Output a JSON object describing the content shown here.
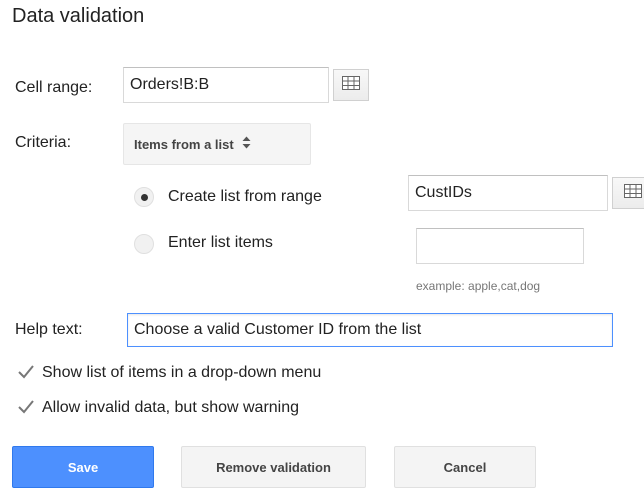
{
  "dialog": {
    "title": "Data validation"
  },
  "cell_range": {
    "label": "Cell range:",
    "value": "Orders!B:B",
    "picker_icon": "grid-icon"
  },
  "criteria": {
    "label": "Criteria:",
    "selected": "Items from a list",
    "options": [
      {
        "label": "Create list from range",
        "selected": true
      },
      {
        "label": "Enter list items",
        "selected": false
      }
    ],
    "range_value": "CustIDs",
    "list_items_value": "",
    "example": "example: apple,cat,dog"
  },
  "help_text": {
    "label": "Help text:",
    "value": "Choose a valid Customer ID from the list"
  },
  "checkboxes": [
    {
      "label": "Show list of items in a drop-down menu",
      "checked": true
    },
    {
      "label": "Allow invalid data, but show warning",
      "checked": true
    }
  ],
  "buttons": {
    "save": "Save",
    "remove": "Remove validation",
    "cancel": "Cancel"
  },
  "colors": {
    "primary": "#4d90fe",
    "focus_border": "#4d90fe"
  }
}
